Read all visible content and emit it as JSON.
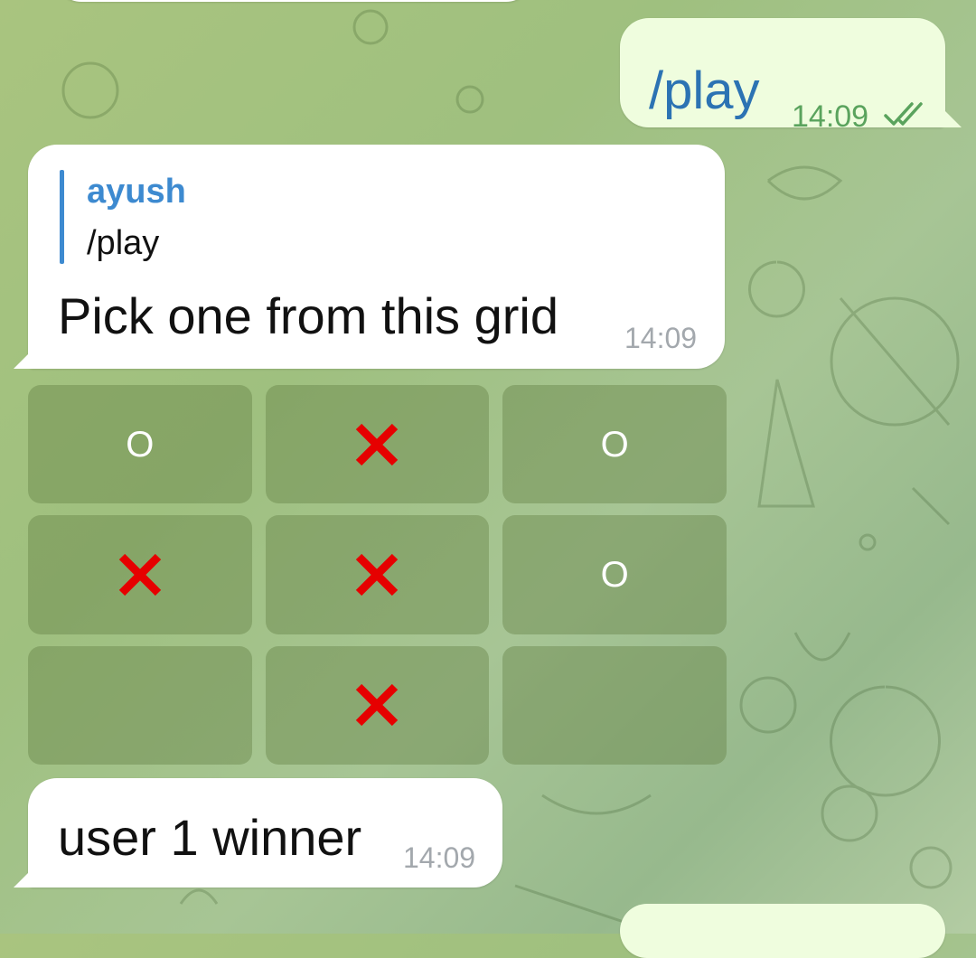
{
  "chat": {
    "outgoing": {
      "text": "/play",
      "time": "14:09",
      "status_icon": "double-check-icon"
    },
    "bot_reply": {
      "reply_to_name": "ayush",
      "reply_to_text": "/play",
      "text": "Pick one from this grid",
      "time": "14:09"
    },
    "grid": [
      [
        "O",
        "X",
        "O"
      ],
      [
        "X",
        "X",
        "O"
      ],
      [
        "",
        "X",
        ""
      ]
    ],
    "result": {
      "text": "user 1 winner",
      "time": "14:09"
    }
  },
  "colors": {
    "x_mark": "#e60000",
    "o_mark": "#ffffff",
    "outgoing_bubble": "#effdde",
    "incoming_bubble": "#ffffff",
    "accent": "#3d8ad0"
  }
}
